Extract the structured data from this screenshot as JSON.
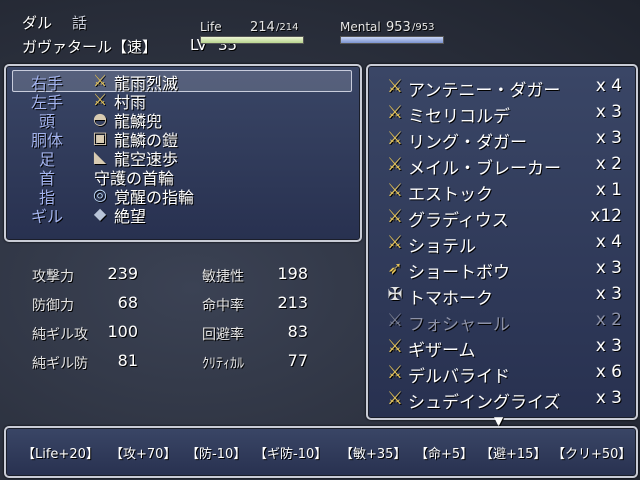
{
  "header": {
    "line1_a": "ダル",
    "line1_b": "話",
    "name": "ガヴァタール【速】",
    "lv_label": "LV",
    "lv_value": "35",
    "life_label": "Life",
    "life_current": "214",
    "life_max": "/214",
    "life_ratio": 1.0,
    "mental_label": "Mental",
    "mental_current": "953",
    "mental_max": "/953",
    "mental_ratio": 1.0
  },
  "colors": {
    "life_bar": "#d6e8b2",
    "mental_bar": "#9bb0e2",
    "slot_label": "#a4b4ee",
    "item_gold": "#e6c55a"
  },
  "equipment": [
    {
      "slot": "右手",
      "icon": "sword-icon",
      "item": "龍雨烈滅"
    },
    {
      "slot": "左手",
      "icon": "sword-icon",
      "item": "村雨"
    },
    {
      "slot": "頭",
      "icon": "helmet-icon",
      "item": "龍鱗兜"
    },
    {
      "slot": "胴体",
      "icon": "armor-icon",
      "item": "龍鱗の鎧"
    },
    {
      "slot": "足",
      "icon": "boots-icon",
      "item": "龍空速歩"
    },
    {
      "slot": "首",
      "icon": "",
      "item": "守護の首輪"
    },
    {
      "slot": "指",
      "icon": "ring-icon",
      "item": "覚醒の指輪"
    },
    {
      "slot": "ギル",
      "icon": "gem-icon",
      "item": "絶望"
    }
  ],
  "inventory": [
    {
      "icon": "sword-icon",
      "name": "アンテニー・ダガー",
      "qty": "x 4",
      "dim": false
    },
    {
      "icon": "sword-icon",
      "name": "ミセリコルデ",
      "qty": "x 3",
      "dim": false
    },
    {
      "icon": "sword-icon",
      "name": "リング・ダガー",
      "qty": "x 3",
      "dim": false
    },
    {
      "icon": "sword-icon",
      "name": "メイル・ブレーカー",
      "qty": "x 2",
      "dim": false
    },
    {
      "icon": "sword-icon",
      "name": "エストック",
      "qty": "x 1",
      "dim": false
    },
    {
      "icon": "sword-icon",
      "name": "グラディウス",
      "qty": "x12",
      "dim": false
    },
    {
      "icon": "sword-icon",
      "name": "ショテル",
      "qty": "x 4",
      "dim": false
    },
    {
      "icon": "bow-icon",
      "name": "ショートボウ",
      "qty": "x 3",
      "dim": false
    },
    {
      "icon": "axe-icon",
      "name": "トマホーク",
      "qty": "x 3",
      "dim": false
    },
    {
      "icon": "sword-icon",
      "name": "フォシャール",
      "qty": "x 2",
      "dim": true
    },
    {
      "icon": "sword-icon",
      "name": "ギザーム",
      "qty": "x 3",
      "dim": false
    },
    {
      "icon": "sword-icon",
      "name": "デルバライド",
      "qty": "x 6",
      "dim": false
    },
    {
      "icon": "sword-icon",
      "name": "シュデイングライズ",
      "qty": "x 3",
      "dim": false
    }
  ],
  "stats": {
    "left": [
      {
        "label": "攻撃力",
        "value": "239"
      },
      {
        "label": "防御力",
        "value": "68"
      },
      {
        "label": "純ギル攻",
        "value": "100"
      },
      {
        "label": "純ギル防",
        "value": "81"
      }
    ],
    "right": [
      {
        "label": "敏捷性",
        "value": "198"
      },
      {
        "label": "命中率",
        "value": "213"
      },
      {
        "label": "回避率",
        "value": "83"
      },
      {
        "label": "ｸﾘﾃｨｶﾙ",
        "value": "77"
      }
    ]
  },
  "bonuses": [
    "【Life+20】",
    "【攻+70】",
    "【防-10】",
    "【ギ防-10】",
    "【敏+35】",
    "【命+5】",
    "【避+15】",
    "【クリ+50】"
  ]
}
